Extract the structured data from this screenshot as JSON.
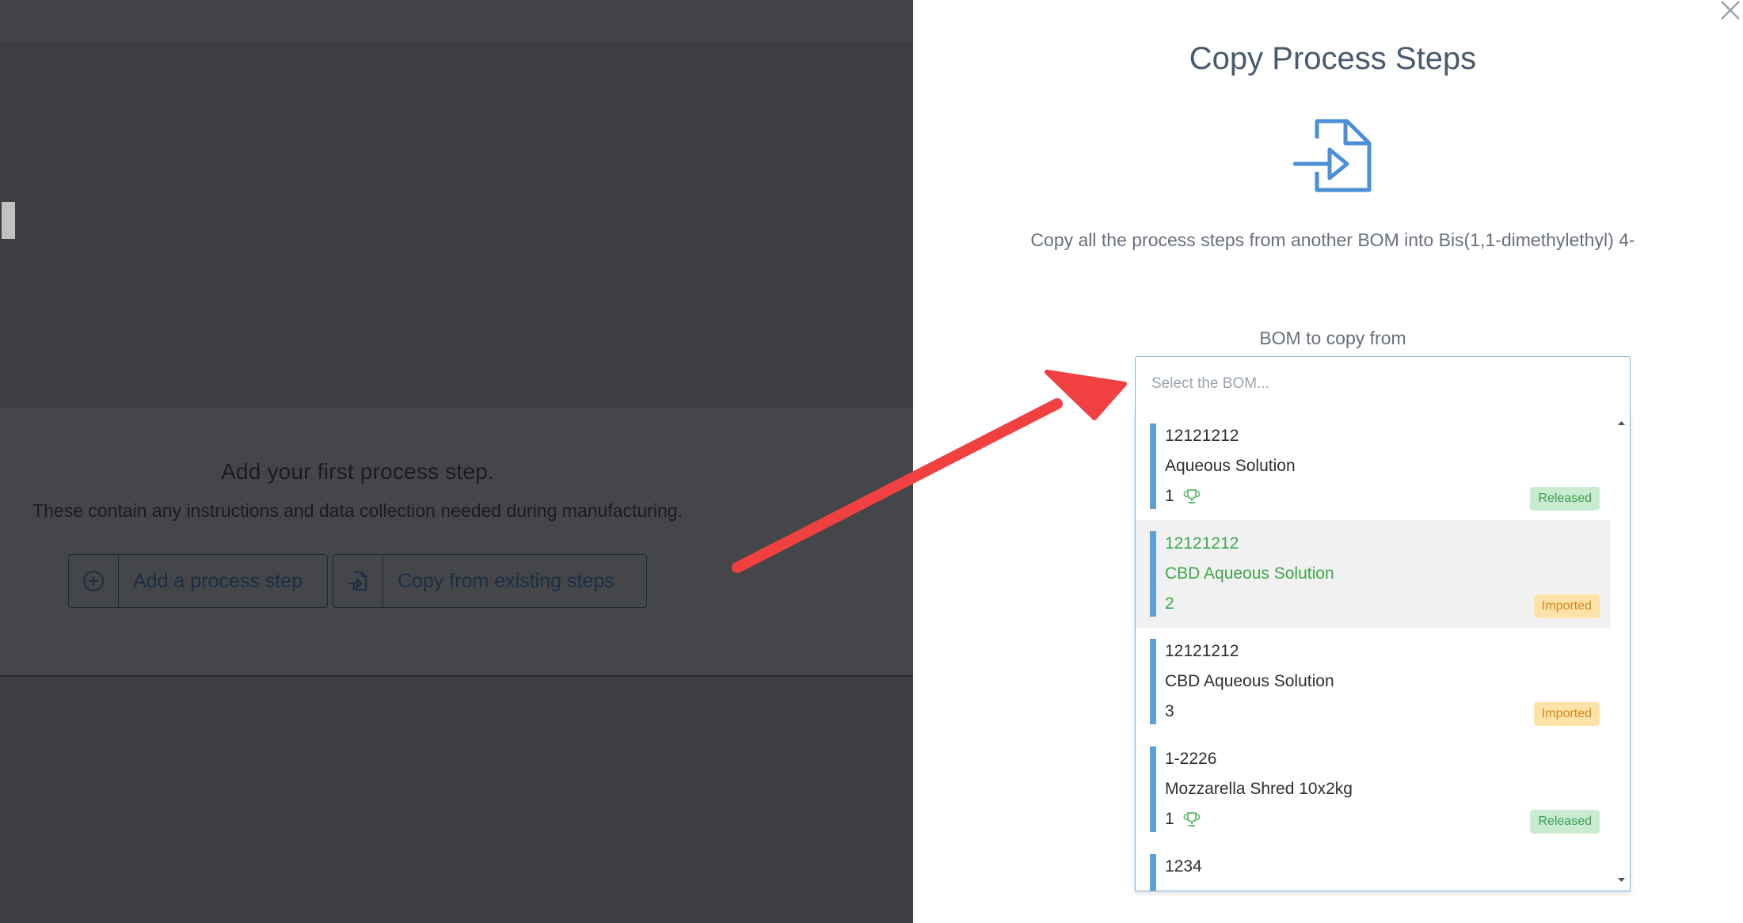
{
  "background": {
    "empty_state_title": "Add your first process step.",
    "empty_state_subtitle": "These contain any instructions and data collection needed during manufacturing.",
    "add_button_label": "Add a process step",
    "copy_button_label": "Copy from existing steps"
  },
  "panel": {
    "title": "Copy Process Steps",
    "description": "Copy all the process steps from another BOM into Bis(1,1-dimethylethyl) 4-",
    "field_label": "BOM to copy from",
    "select_placeholder": "Select the BOM...",
    "options": [
      {
        "code": "12121212",
        "name": "Aqueous Solution",
        "version": "1",
        "default": true,
        "status": "Released",
        "highlighted": false
      },
      {
        "code": "12121212",
        "name": "CBD Aqueous Solution",
        "version": "2",
        "default": false,
        "status": "Imported",
        "highlighted": true
      },
      {
        "code": "12121212",
        "name": "CBD Aqueous Solution",
        "version": "3",
        "default": false,
        "status": "Imported",
        "highlighted": false
      },
      {
        "code": "1-2226",
        "name": "Mozzarella Shred 10x2kg",
        "version": "1",
        "default": true,
        "status": "Released",
        "highlighted": false
      },
      {
        "code": "1234",
        "name": "",
        "version": "",
        "default": false,
        "status": "",
        "highlighted": false
      }
    ]
  },
  "colors": {
    "accent_blue": "#5e9fd6",
    "released_bg": "#c9ecd0",
    "released_text": "#3e9a52",
    "imported_bg": "#fde3a8",
    "imported_text": "#d2881d",
    "highlight_text": "#3ea84a",
    "arrow": "#f04040"
  },
  "icons": {
    "close": "close-icon",
    "file_import": "file-import-icon",
    "trophy": "trophy-icon",
    "plus_circle": "plus-circle-icon"
  }
}
